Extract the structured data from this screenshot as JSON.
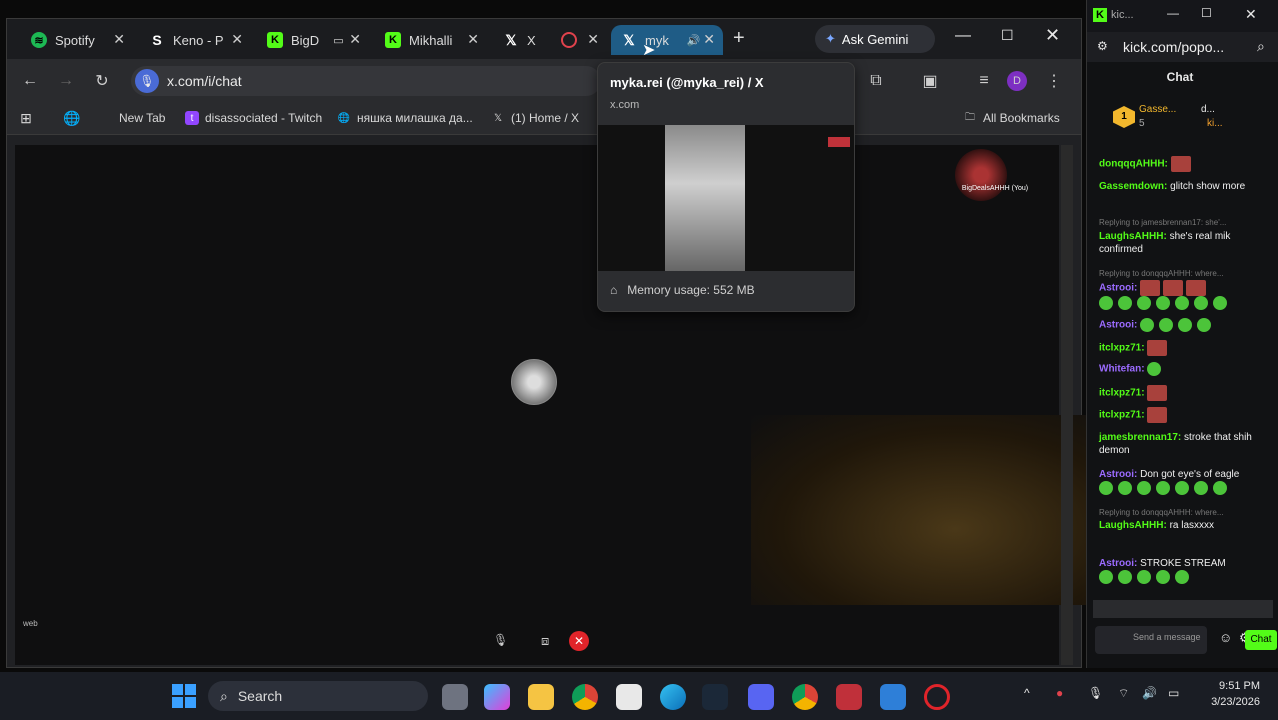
{
  "browser": {
    "tabs": [
      {
        "label": "Spotify",
        "icon": "spotify-icon",
        "color": "#1db954"
      },
      {
        "label": "Keno - P",
        "icon": "stake-icon",
        "color": "#ffffff"
      },
      {
        "label": "BigD",
        "icon": "kick-icon",
        "color": "#53fc18"
      },
      {
        "label": "Mikhalli",
        "icon": "kick-icon",
        "color": "#53fc18"
      },
      {
        "label": "X",
        "icon": "x-icon",
        "color": "#ffffff"
      },
      {
        "label": "",
        "icon": "record-icon",
        "color": "#e0424c"
      },
      {
        "label": "myk",
        "icon": "x-icon",
        "color": "#ffffff"
      }
    ],
    "new_tab_symbol": "+",
    "ask_gemini": "Ask Gemini",
    "url": "x.com/i/chat",
    "bookmarks": [
      "New Tab",
      "disassociated - Twitch",
      "няшка милашка да...",
      "(1) Home / X"
    ],
    "all_bookmarks": "All Bookmarks",
    "profile_initial": "D",
    "call_label": "BigDealsAHHH (You)",
    "web_label": "web"
  },
  "hover_card": {
    "title": "myka.rei (@myka_rei) / X",
    "domain": "x.com",
    "memory": "Memory usage: 552 MB"
  },
  "chat_window": {
    "url": "kick.com/popo...",
    "title_short": "kic...",
    "header": "Chat",
    "top_users": [
      "Gasse...",
      "d...",
      "ki..."
    ],
    "top_count": "5",
    "messages": [
      {
        "user": "donqqqAHHH:",
        "text": "",
        "user_color": "#53fc18"
      },
      {
        "user": "Gassemdown:",
        "text": "glitch show more",
        "user_color": "#53fc18"
      },
      {
        "reply": "Replying to jamesbrennan17: she'..."
      },
      {
        "user": "LaughsAHHH:",
        "text": "she's real mik confirmed",
        "user_color": "#53fc18"
      },
      {
        "reply": "Replying to donqqqAHHH: where..."
      },
      {
        "user": "Astrooi:",
        "text": "",
        "user_color": "#9b6bff"
      },
      {
        "user": "Astrooi:",
        "text": "",
        "user_color": "#9b6bff"
      },
      {
        "user": "itclxpz71:",
        "text": "",
        "user_color": "#53fc18"
      },
      {
        "user": "Whitefan:",
        "text": "",
        "user_color": "#9b6bff"
      },
      {
        "user": "itclxpz71:",
        "text": "",
        "user_color": "#53fc18"
      },
      {
        "user": "itclxpz71:",
        "text": "",
        "user_color": "#53fc18"
      },
      {
        "user": "jamesbrennan17:",
        "text": "stroke that shih demon",
        "user_color": "#53fc18"
      },
      {
        "user": "Astrooi:",
        "text": "Don got eye's of eagle",
        "user_color": "#9b6bff"
      },
      {
        "reply": "Replying to donqqqAHHH: where..."
      },
      {
        "user": "LaughsAHHH:",
        "text": "ra lasxxxx",
        "user_color": "#53fc18"
      },
      {
        "user": "Astrooi:",
        "text": "STROKE STREAM",
        "user_color": "#9b6bff"
      }
    ],
    "input_placeholder": "Send a message",
    "send_label": "Chat"
  },
  "taskbar": {
    "search_label": "Search",
    "time": "9:51 PM",
    "date": "3/23/2026"
  }
}
